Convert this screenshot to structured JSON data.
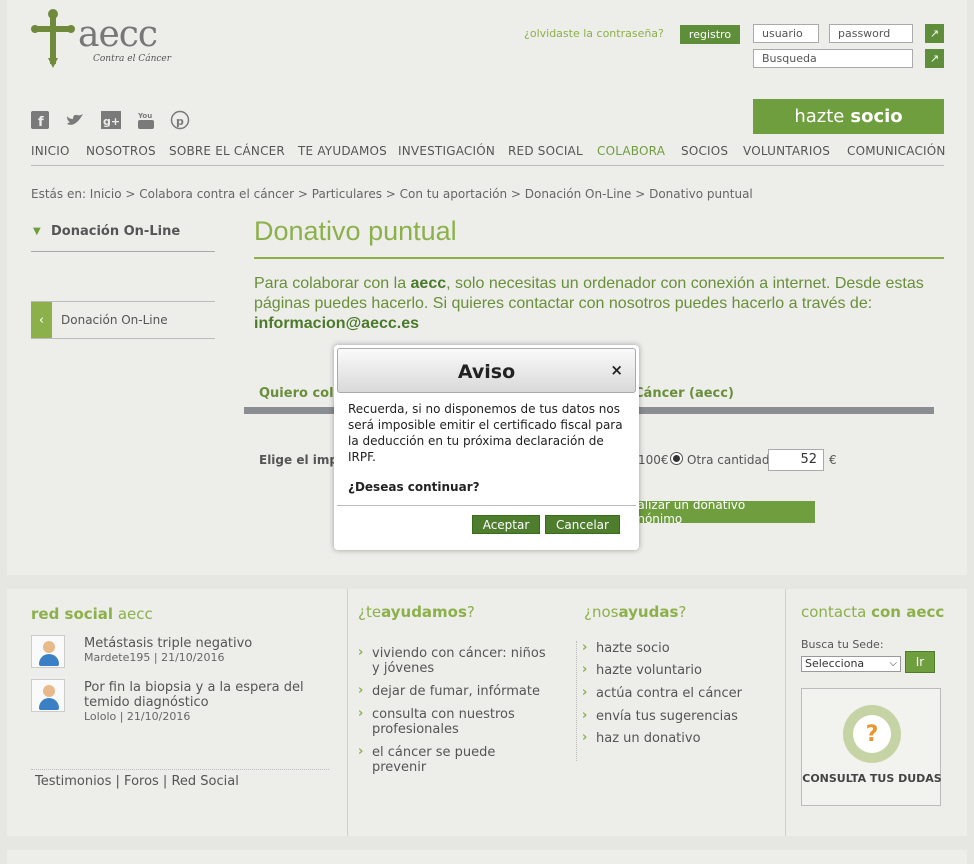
{
  "header": {
    "logo_text": "aecc",
    "logo_sub": "Contra el Cáncer",
    "forgot_link": "¿olvidaste la contraseña?",
    "register_button": "registro",
    "user_placeholder": "usuario",
    "password_placeholder": "password",
    "search_placeholder": "Busqueda",
    "go_glyph": "↗",
    "hazte_prefix": "hazte",
    "hazte_bold": "socio",
    "social_icons": [
      "facebook-icon",
      "twitter-icon",
      "googleplus-icon",
      "youtube-icon",
      "pinterest-icon"
    ]
  },
  "nav": {
    "items": [
      "INICIO",
      "NOSOTROS",
      "SOBRE EL CÁNCER",
      "TE AYUDAMOS",
      "INVESTIGACIÓN",
      "RED SOCIAL",
      "COLABORA",
      "SOCIOS",
      "VOLUNTARIOS",
      "COMUNICACIÓN"
    ],
    "active": "COLABORA"
  },
  "breadcrumb": "Estás en: Inicio > Colabora contra el cáncer > Particulares > Con tu aportación > Donación On-Line > Donativo puntual",
  "sidebar": {
    "title": "Donación On-Line",
    "item": "Donación On-Line"
  },
  "main": {
    "title": "Donativo puntual",
    "intro_pre": "Para colaborar con la ",
    "intro_bold": "aecc",
    "intro_post": ", solo necesitas un ordenador con conexión a internet. Desde estas páginas puedes hacerlo. Si quieres contactar con nosotros puedes hacerlo a través de:",
    "email": "informacion@aecc.es",
    "quiero_left": "Quiero cola",
    "quiero_right": "Cáncer (aecc)",
    "elige": "Elige el imp",
    "importe_100": "100€",
    "otra_cantidad": "Otra cantidad",
    "amount_value": "52",
    "currency": "€",
    "anon_button": "ealizar un donativo anónimo"
  },
  "modal": {
    "title": "Aviso",
    "close": "×",
    "body": "Recuerda, si no disponemos de tus datos nos será imposible emitir el certificado fiscal para la deducción en tu próxima declaración de IRPF.",
    "question": "¿Deseas continuar?",
    "accept": "Aceptar",
    "cancel": "Cancelar"
  },
  "footer": {
    "red_social": {
      "head_bold": "red social",
      "head_small": "aecc",
      "posts": [
        {
          "title": "Metástasis triple negativo",
          "meta": "Mardete195 | 21/10/2016"
        },
        {
          "title": "Por fin la biopsia y a la espera del temido diagnóstico",
          "meta": "Lololo | 21/10/2016"
        }
      ],
      "links": "Testimonios | Foros | Red Social"
    },
    "te_ayudamos": {
      "head_pre": "¿te",
      "head_bold": "ayudamos",
      "head_post": "?",
      "items": [
        "viviendo con cáncer: niños y jóvenes",
        "dejar de fumar, infórmate",
        "consulta con nuestros profesionales",
        "el cáncer se puede prevenir"
      ]
    },
    "nos_ayudas": {
      "head_pre": "¿nos",
      "head_bold": "ayudas",
      "head_post": "?",
      "items": [
        "hazte socio",
        "hazte voluntario",
        "actúa contra el cáncer",
        "envía tus sugerencias",
        "haz un donativo"
      ]
    },
    "contacta": {
      "head_pre": "contacta",
      "head_bold": "con aecc",
      "busca": "Busca tu Sede:",
      "select_value": "Selecciona",
      "ir": "Ir",
      "dudas": "CONSULTA TUS DUDAS",
      "dudas_glyph": "?"
    }
  },
  "colors": {
    "green": "#6f9e3e",
    "light_green": "#8cb04a",
    "dark_green": "#4e7d2e"
  }
}
